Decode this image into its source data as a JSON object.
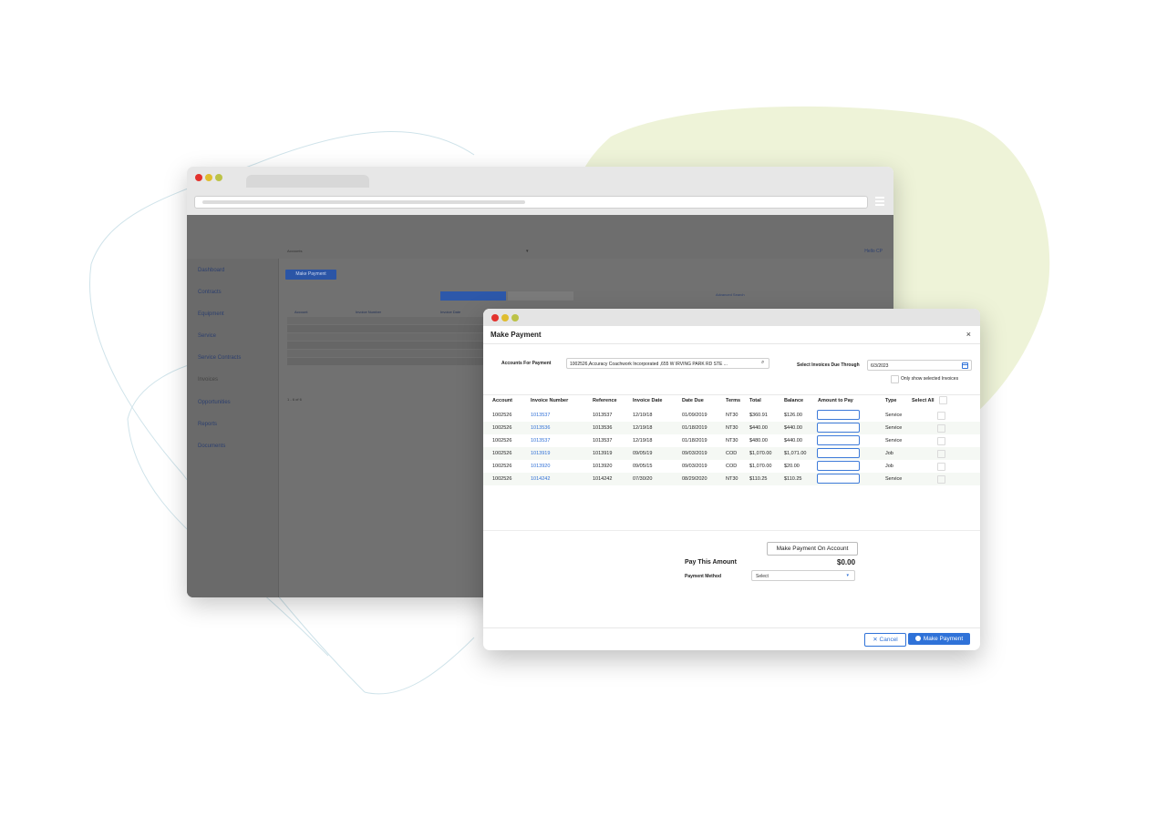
{
  "background_window": {
    "header": {
      "accounts_label": "Accounts",
      "greeting": "Hello CP"
    },
    "sidebar": [
      {
        "label": "Dashboard"
      },
      {
        "label": "Contracts"
      },
      {
        "label": "Equipment"
      },
      {
        "label": "Service"
      },
      {
        "label": "Service Contracts"
      },
      {
        "label": "Invoices"
      },
      {
        "label": "Opportunities"
      },
      {
        "label": "Reports"
      },
      {
        "label": "Documents"
      }
    ],
    "make_payment_button": "Make Payment",
    "advanced_search": "Advanced Search",
    "table_headers": [
      "Account",
      "Invoice Number",
      "Invoice Date"
    ],
    "paging": "1 - 6 of 6"
  },
  "modal": {
    "title": "Make Payment",
    "close_glyph": "×",
    "accounts_for_payment_label": "Accounts For Payment",
    "accounts_value": "1002526,Accuracy Coachwork Incorporated ,655 W IRVING PARK RD STE ...",
    "select_invoices_label": "Select Invoices Due Through",
    "due_date_value": "6/3/2023",
    "only_selected_label": "Only show selected Invoices",
    "columns": [
      "Account",
      "Invoice Number",
      "Reference",
      "Invoice Date",
      "Date Due",
      "Terms",
      "Total",
      "Balance",
      "Amount to Pay",
      "Type",
      "Select All"
    ],
    "rows": [
      {
        "account": "1002526",
        "invoice": "1013537",
        "reference": "1013537",
        "invoice_date": "12/10/18",
        "date_due": "01/09/2019",
        "terms": "NT30",
        "total": "$360.91",
        "balance": "$126.00",
        "type": "Service"
      },
      {
        "account": "1002526",
        "invoice": "1013536",
        "reference": "1013536",
        "invoice_date": "12/19/18",
        "date_due": "01/18/2019",
        "terms": "NT30",
        "total": "$440.00",
        "balance": "$440.00",
        "type": "Service"
      },
      {
        "account": "1002526",
        "invoice": "1013537",
        "reference": "1013537",
        "invoice_date": "12/19/18",
        "date_due": "01/18/2019",
        "terms": "NT30",
        "total": "$480.00",
        "balance": "$440.00",
        "type": "Service"
      },
      {
        "account": "1002526",
        "invoice": "1013919",
        "reference": "1013919",
        "invoice_date": "09/05/19",
        "date_due": "09/03/2019",
        "terms": "COD",
        "total": "$1,070.00",
        "balance": "$1,071.00",
        "type": "Job"
      },
      {
        "account": "1002526",
        "invoice": "1013920",
        "reference": "1013920",
        "invoice_date": "09/05/15",
        "date_due": "09/03/2019",
        "terms": "COD",
        "total": "$1,070.00",
        "balance": "$20.00",
        "type": "Job"
      },
      {
        "account": "1002526",
        "invoice": "1014242",
        "reference": "1014242",
        "invoice_date": "07/30/20",
        "date_due": "08/29/2020",
        "terms": "NT30",
        "total": "$110.25",
        "balance": "$110.25",
        "type": "Service"
      }
    ],
    "make_payment_on_account": "Make Payment On Account",
    "pay_this_amount_label": "Pay This Amount",
    "pay_this_amount_value": "$0.00",
    "payment_method_label": "Payment Method",
    "payment_method_value": "Select",
    "cancel_label": "Cancel",
    "cancel_glyph": "✕",
    "make_payment_label": "Make Payment"
  },
  "colors": {
    "accent": "#2f72d8",
    "link": "#2f6fd6",
    "blob": "#eef3d8",
    "outline": "#cfe3ea"
  }
}
